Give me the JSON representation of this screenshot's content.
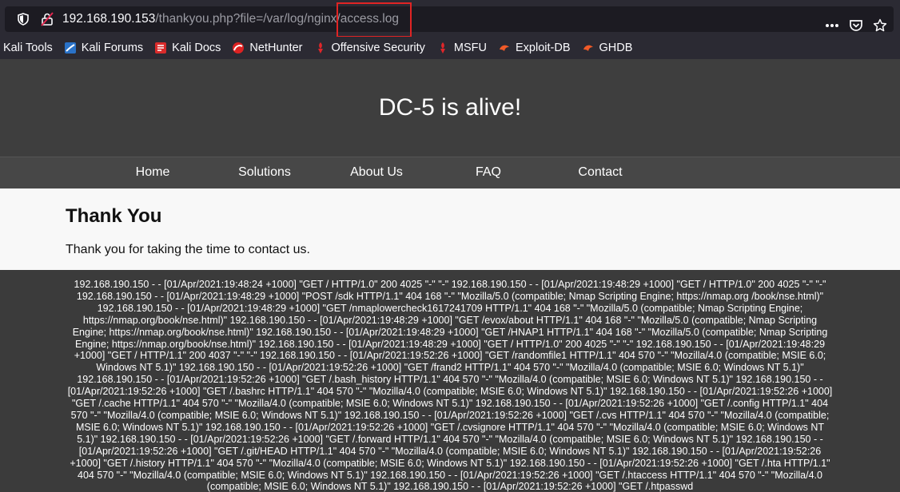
{
  "browser": {
    "url_host": "192.168.190.153",
    "url_path": "/thankyou.php?file=/var/log/nginx/access.log",
    "actions": [
      "more-icon",
      "pocket-icon",
      "bookmark-star-icon"
    ]
  },
  "bookmarks": [
    {
      "label": "Kali Tools",
      "icon": "none"
    },
    {
      "label": "Kali Forums",
      "icon": "kali-forums-icon"
    },
    {
      "label": "Kali Docs",
      "icon": "kali-docs-icon"
    },
    {
      "label": "NetHunter",
      "icon": "nethunter-icon"
    },
    {
      "label": "Offensive Security",
      "icon": "offsec-icon"
    },
    {
      "label": "MSFU",
      "icon": "msfu-icon"
    },
    {
      "label": "Exploit-DB",
      "icon": "exploitdb-icon"
    },
    {
      "label": "GHDB",
      "icon": "ghdb-icon"
    }
  ],
  "site": {
    "title": "DC-5 is alive!",
    "nav": [
      "Home",
      "Solutions",
      "About Us",
      "FAQ",
      "Contact"
    ]
  },
  "content": {
    "heading": "Thank You",
    "message": "Thank you for taking the time to contact us."
  },
  "log": {
    "text": "192.168.190.150 - - [01/Apr/2021:19:48:24 +1000] \"GET / HTTP/1.0\" 200 4025 \"-\" \"-\" 192.168.190.150 - - [01/Apr/2021:19:48:29 +1000] \"GET / HTTP/1.0\" 200 4025 \"-\" \"-\" 192.168.190.150 - - [01/Apr/2021:19:48:29 +1000] \"POST /sdk HTTP/1.1\" 404 168 \"-\" \"Mozilla/5.0 (compatible; Nmap Scripting Engine; https://nmap.org /book/nse.html)\" 192.168.190.150 - - [01/Apr/2021:19:48:29 +1000] \"GET /nmaplowercheck1617241709 HTTP/1.1\" 404 168 \"-\" \"Mozilla/5.0 (compatible; Nmap Scripting Engine; https://nmap.org/book/nse.html)\" 192.168.190.150 - - [01/Apr/2021:19:48:29 +1000] \"GET /evox/about HTTP/1.1\" 404 168 \"-\" \"Mozilla/5.0 (compatible; Nmap Scripting Engine; https://nmap.org/book/nse.html)\" 192.168.190.150 - - [01/Apr/2021:19:48:29 +1000] \"GET /HNAP1 HTTP/1.1\" 404 168 \"-\" \"Mozilla/5.0 (compatible; Nmap Scripting Engine; https://nmap.org/book/nse.html)\" 192.168.190.150 - - [01/Apr/2021:19:48:29 +1000] \"GET / HTTP/1.0\" 200 4025 \"-\" \"-\" 192.168.190.150 - - [01/Apr/2021:19:48:29 +1000] \"GET / HTTP/1.1\" 200 4037 \"-\" \"-\" 192.168.190.150 - - [01/Apr/2021:19:52:26 +1000] \"GET /randomfile1 HTTP/1.1\" 404 570 \"-\" \"Mozilla/4.0 (compatible; MSIE 6.0; Windows NT 5.1)\" 192.168.190.150 - - [01/Apr/2021:19:52:26 +1000] \"GET /frand2 HTTP/1.1\" 404 570 \"-\" \"Mozilla/4.0 (compatible; MSIE 6.0; Windows NT 5.1)\" 192.168.190.150 - - [01/Apr/2021:19:52:26 +1000] \"GET /.bash_history HTTP/1.1\" 404 570 \"-\" \"Mozilla/4.0 (compatible; MSIE 6.0; Windows NT 5.1)\" 192.168.190.150 - - [01/Apr/2021:19:52:26 +1000] \"GET /.bashrc HTTP/1.1\" 404 570 \"-\" \"Mozilla/4.0 (compatible; MSIE 6.0; Windows NT 5.1)\" 192.168.190.150 - - [01/Apr/2021:19:52:26 +1000] \"GET /.cache HTTP/1.1\" 404 570 \"-\" \"Mozilla/4.0 (compatible; MSIE 6.0; Windows NT 5.1)\" 192.168.190.150 - - [01/Apr/2021:19:52:26 +1000] \"GET /.config HTTP/1.1\" 404 570 \"-\" \"Mozilla/4.0 (compatible; MSIE 6.0; Windows NT 5.1)\" 192.168.190.150 - - [01/Apr/2021:19:52:26 +1000] \"GET /.cvs HTTP/1.1\" 404 570 \"-\" \"Mozilla/4.0 (compatible; MSIE 6.0; Windows NT 5.1)\" 192.168.190.150 - - [01/Apr/2021:19:52:26 +1000] \"GET /.cvsignore HTTP/1.1\" 404 570 \"-\" \"Mozilla/4.0 (compatible; MSIE 6.0; Windows NT 5.1)\" 192.168.190.150 - - [01/Apr/2021:19:52:26 +1000] \"GET /.forward HTTP/1.1\" 404 570 \"-\" \"Mozilla/4.0 (compatible; MSIE 6.0; Windows NT 5.1)\" 192.168.190.150 - - [01/Apr/2021:19:52:26 +1000] \"GET /.git/HEAD HTTP/1.1\" 404 570 \"-\" \"Mozilla/4.0 (compatible; MSIE 6.0; Windows NT 5.1)\" 192.168.190.150 - - [01/Apr/2021:19:52:26 +1000] \"GET /.history HTTP/1.1\" 404 570 \"-\" \"Mozilla/4.0 (compatible; MSIE 6.0; Windows NT 5.1)\" 192.168.190.150 - - [01/Apr/2021:19:52:26 +1000] \"GET /.hta HTTP/1.1\" 404 570 \"-\" \"Mozilla/4.0 (compatible; MSIE 6.0; Windows NT 5.1)\" 192.168.190.150 - - [01/Apr/2021:19:52:26 +1000] \"GET /.htaccess HTTP/1.1\" 404 570 \"-\" \"Mozilla/4.0 (compatible; MSIE 6.0; Windows NT 5.1)\" 192.168.190.150 - - [01/Apr/2021:19:52:26 +1000] \"GET /.htpasswd"
  },
  "colors": {
    "chrome_bg": "#2b2a33",
    "url_field_bg": "#1c1b22",
    "header_bg": "#3e3e3e",
    "nav_bg": "#474747",
    "content_bg": "#f8f8f8",
    "highlight": "#e02424"
  }
}
